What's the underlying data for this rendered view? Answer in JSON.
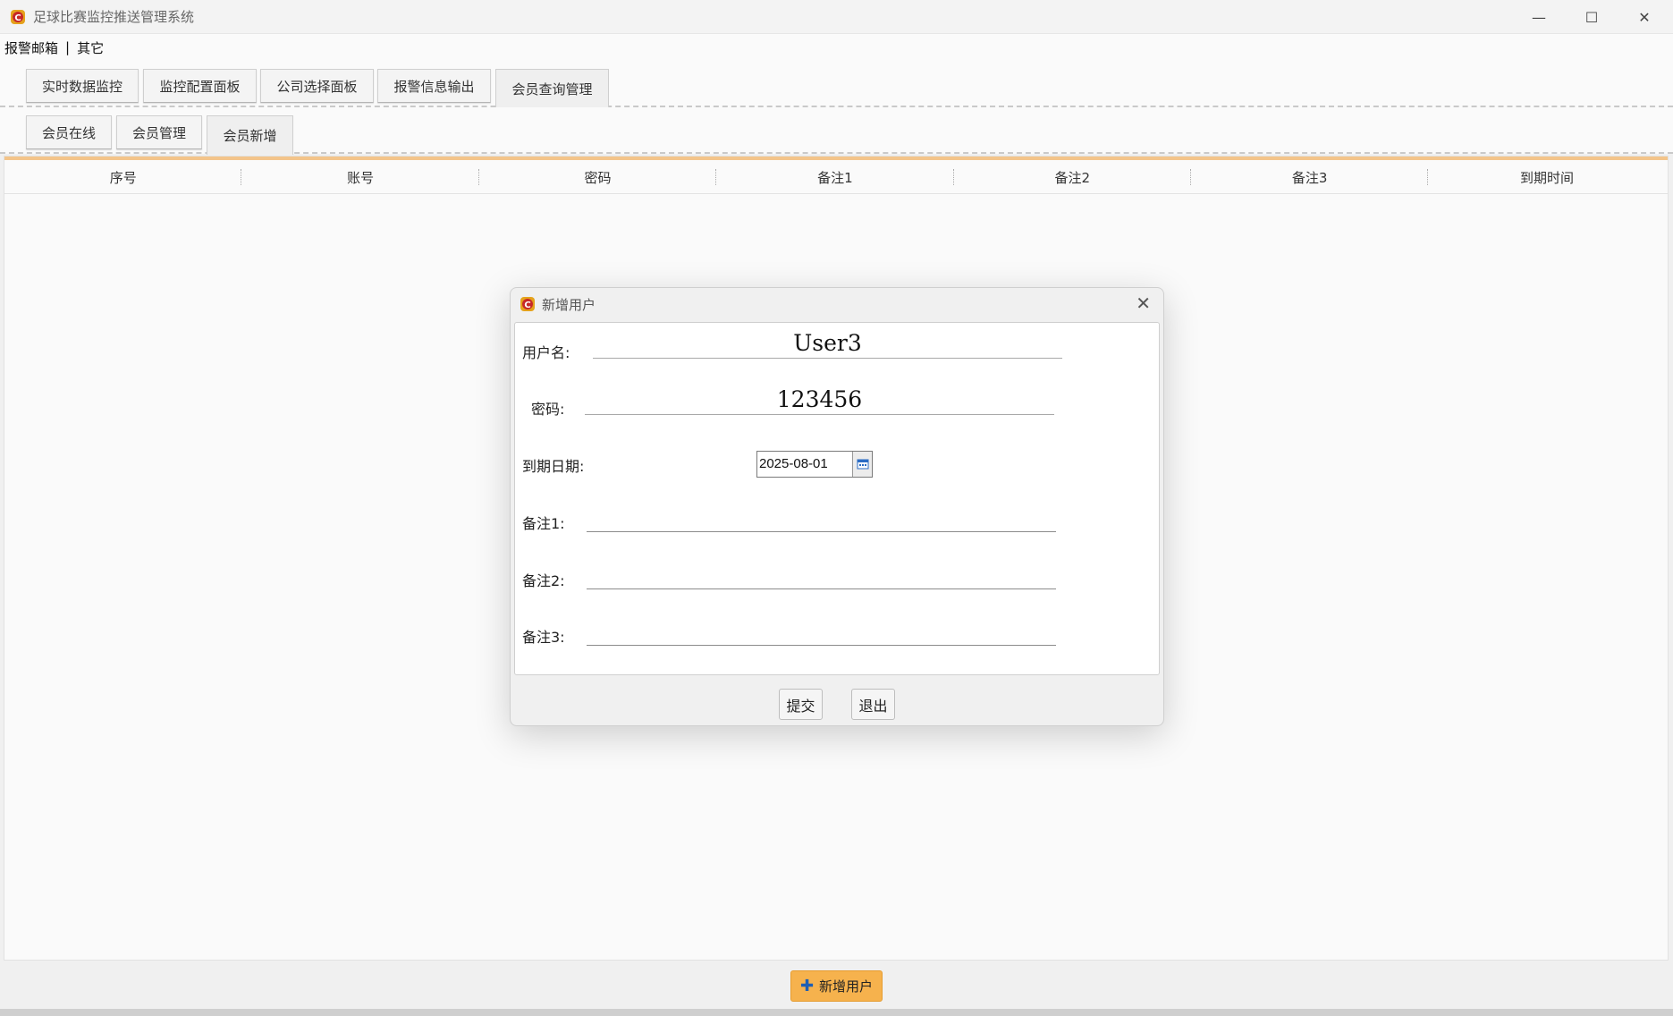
{
  "window": {
    "title": "足球比赛监控推送管理系统",
    "controls": {
      "minimize": "—",
      "maximize": "☐",
      "close": "✕"
    }
  },
  "menu": {
    "items": [
      "报警邮箱",
      "其它"
    ],
    "separator": "|"
  },
  "main_tabs": [
    "实时数据监控",
    "监控配置面板",
    "公司选择面板",
    "报警信息输出",
    "会员查询管理"
  ],
  "sub_tabs": [
    "会员在线",
    "会员管理",
    "会员新增"
  ],
  "table": {
    "columns": [
      "序号",
      "账号",
      "密码",
      "备注1",
      "备注2",
      "备注3",
      "到期时间"
    ],
    "rows": []
  },
  "bottom": {
    "add_user_label": "新增用户"
  },
  "dialog": {
    "title": "新增用户",
    "close": "✕",
    "fields": {
      "username": {
        "label": "用户名:",
        "value": "User3"
      },
      "password": {
        "label": "密码:",
        "value": "123456"
      },
      "expiry": {
        "label": "到期日期:",
        "value": "2025-08-01"
      },
      "note1": {
        "label": "备注1:",
        "value": ""
      },
      "note2": {
        "label": "备注2:",
        "value": ""
      },
      "note3": {
        "label": "备注3:",
        "value": ""
      }
    },
    "submit_label": "提交",
    "exit_label": "退出"
  },
  "colors": {
    "accent": "#f6b24d",
    "grid_top_line": "#f3c48a"
  }
}
